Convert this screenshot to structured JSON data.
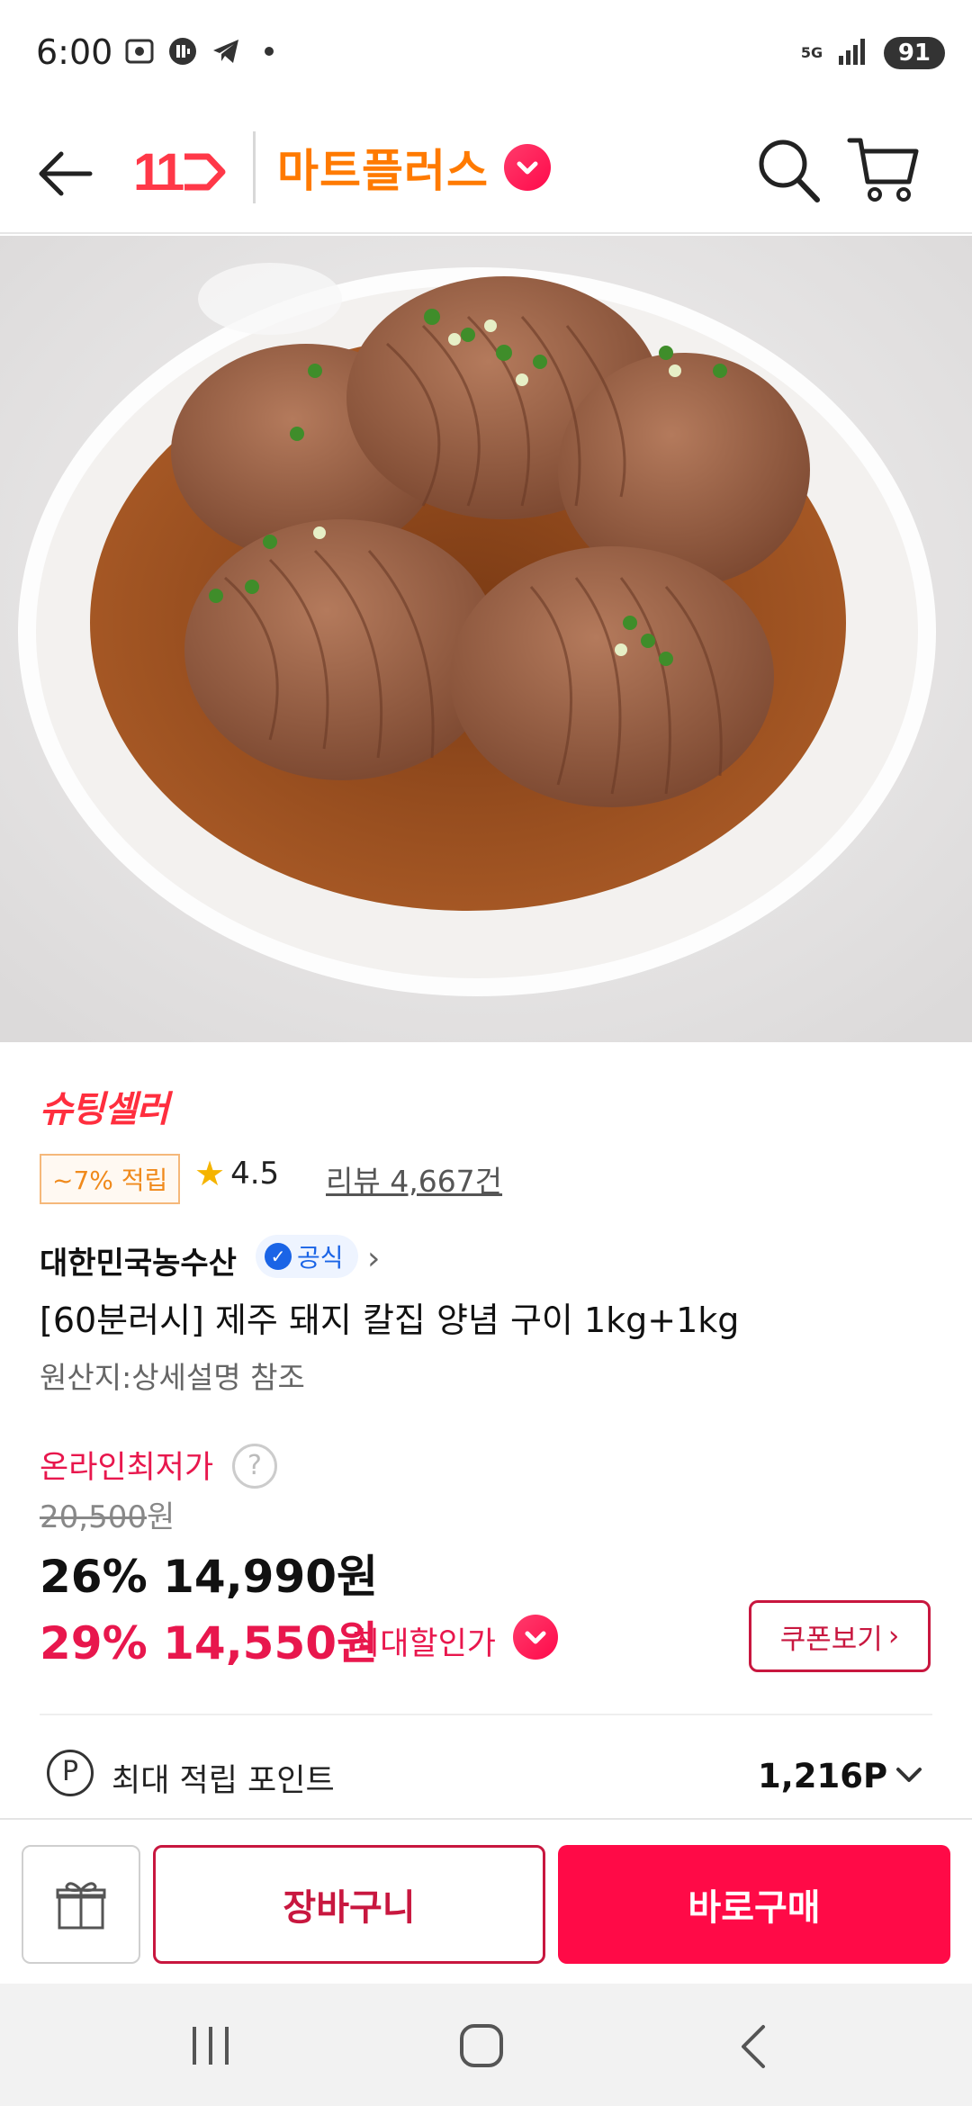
{
  "status_bar": {
    "time": "6:00",
    "network": "5G",
    "battery": "91",
    "icons": [
      "screenshot-icon",
      "app-notification-icon",
      "telegram-icon",
      "dot-icon",
      "signal-icon"
    ]
  },
  "header": {
    "logo_text": "11",
    "mart_title": "마트플러스",
    "icons": [
      "back-arrow-icon",
      "chevron-down-icon",
      "search-icon",
      "cart-icon"
    ],
    "accent_color": "#ff0a47",
    "mart_color": "#ff7a00"
  },
  "product": {
    "seller_badge": "슈팅셀러",
    "point_chip": "~7% 적립",
    "rating": "4.5",
    "review": "리뷰 4,667건",
    "store_name": "대한민국농수산",
    "official_label": "공식",
    "title": "[60분러시] 제주 돼지 칼집 양념 구이 1kg+1kg",
    "origin": "원산지:상세설명 참조"
  },
  "price": {
    "lowest_label": "온라인최저가",
    "original_price": "20,500",
    "original_unit": "원",
    "discount_1": "26%",
    "price_1": "14,990원",
    "discount_2": "29%",
    "price_2": "14,550원",
    "max_discount_label": "최대할인가",
    "coupon_button": "쿠폰보기"
  },
  "points": {
    "label": "최대 적립 포인트",
    "value": "1,216P"
  },
  "bottom_bar": {
    "cart_button": "장바구니",
    "buy_button": "바로구매"
  }
}
